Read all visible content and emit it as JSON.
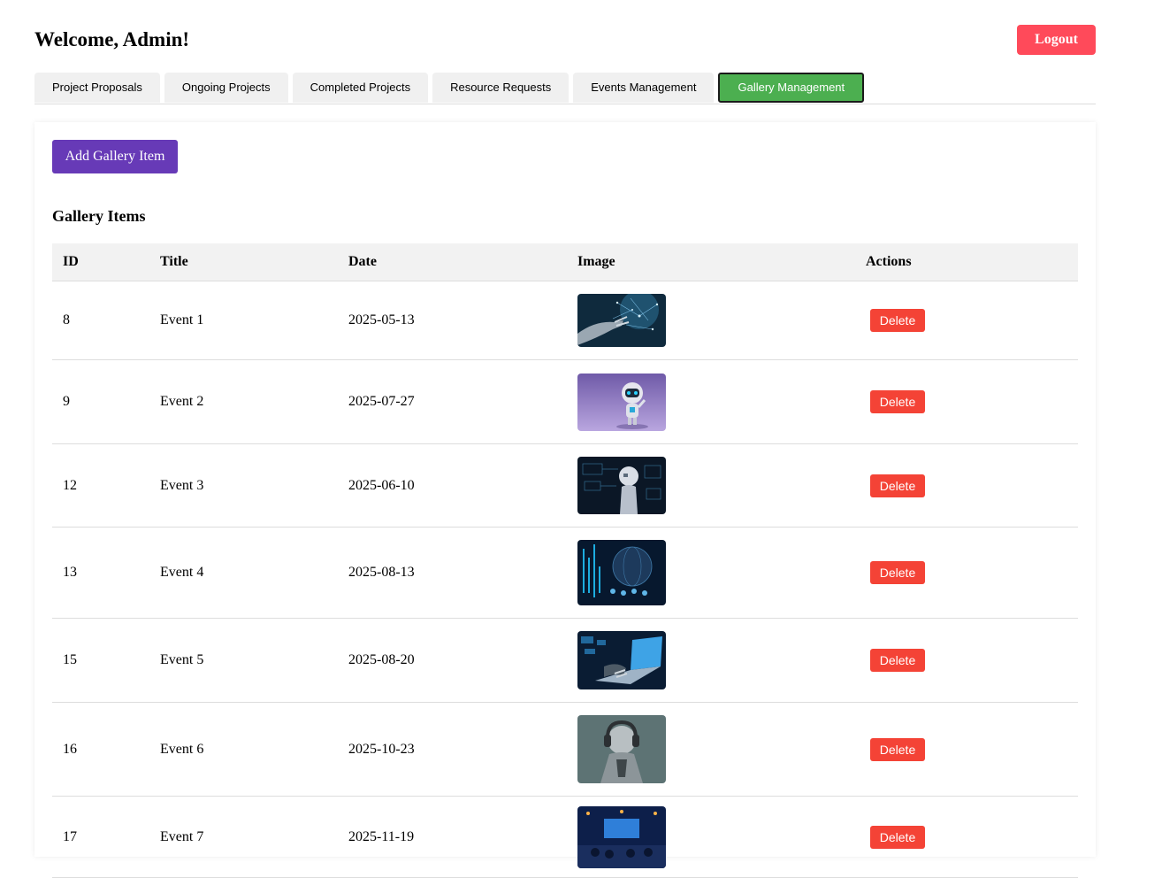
{
  "header": {
    "welcome": "Welcome, Admin!",
    "logout_label": "Logout"
  },
  "tabs": [
    {
      "label": "Project Proposals",
      "active": false
    },
    {
      "label": "Ongoing Projects",
      "active": false
    },
    {
      "label": "Completed Projects",
      "active": false
    },
    {
      "label": "Resource Requests",
      "active": false
    },
    {
      "label": "Events Management",
      "active": false
    },
    {
      "label": "Gallery Management",
      "active": true
    }
  ],
  "gallery": {
    "add_label": "Add Gallery Item",
    "section_title": "Gallery Items",
    "columns": [
      "ID",
      "Title",
      "Date",
      "Image",
      "Actions"
    ],
    "delete_label": "Delete",
    "rows": [
      {
        "id": "8",
        "title": "Event 1",
        "date": "2025-05-13",
        "image": "ai-hand-network-thumbnail"
      },
      {
        "id": "9",
        "title": "Event 2",
        "date": "2025-07-27",
        "image": "robot-purple-thumbnail"
      },
      {
        "id": "12",
        "title": "Event 3",
        "date": "2025-06-10",
        "image": "android-circuit-thumbnail"
      },
      {
        "id": "13",
        "title": "Event 4",
        "date": "2025-08-13",
        "image": "digital-globe-thumbnail"
      },
      {
        "id": "15",
        "title": "Event 5",
        "date": "2025-08-20",
        "image": "laptop-typing-thumbnail"
      },
      {
        "id": "16",
        "title": "Event 6",
        "date": "2025-10-23",
        "image": "cyborg-headphones-thumbnail"
      },
      {
        "id": "17",
        "title": "Event 7",
        "date": "2025-11-19",
        "image": "stage-event-thumbnail"
      }
    ]
  },
  "colors": {
    "logout": "#ff4a5a",
    "active_tab": "#4caf50",
    "add_button": "#673ab7",
    "delete_button": "#f44336"
  }
}
